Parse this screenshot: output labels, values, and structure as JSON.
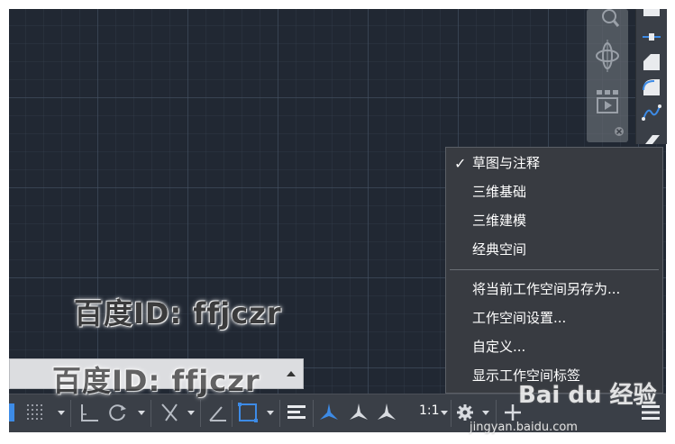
{
  "workspace_menu": {
    "items": [
      {
        "label": "草图与注释",
        "checked": true
      },
      {
        "label": "三维基础",
        "checked": false
      },
      {
        "label": "三维建模",
        "checked": false
      },
      {
        "label": "经典空间",
        "checked": false
      },
      {
        "label": "将当前工作空间另存为...",
        "checked": false
      },
      {
        "label": "工作空间设置...",
        "checked": false
      },
      {
        "label": "自定义...",
        "checked": false
      },
      {
        "label": "显示工作空间标签",
        "checked": false
      }
    ],
    "check_glyph": "✓"
  },
  "statusbar": {
    "annotation_scale": "1:1",
    "icons": [
      "grid-icon",
      "snap-icon",
      "ortho-icon",
      "polar-icon",
      "object-snap-icon",
      "dynamic-ucs-icon",
      "selection-cycling-icon",
      "lineweight-icon",
      "annotation-visibility-icon",
      "auto-scale-icon",
      "annotation-scale-icon",
      "workspace-gear-icon",
      "plus-icon",
      "customize-menu-icon"
    ]
  },
  "watermark": {
    "text": "百度ID: ffjczr",
    "brand": "Bai du 经验",
    "url": "jingyan.baidu.com"
  },
  "colors": {
    "canvas_bg": "#212833",
    "menu_bg": "#383b41",
    "statusbar_bg": "#3a3f47",
    "accent_blue": "#3d8be6"
  }
}
